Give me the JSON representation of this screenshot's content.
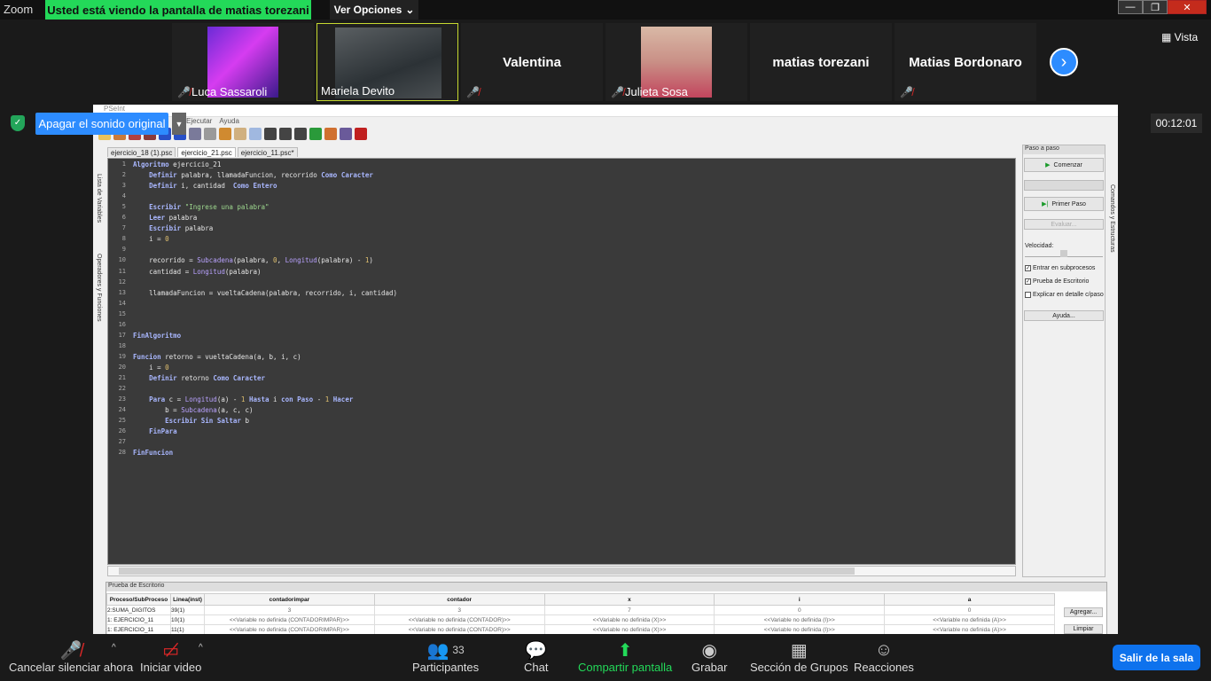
{
  "zoom": {
    "app_label": "Zoom",
    "viewing_banner": "Usted está viendo la pantalla de matias torezani",
    "view_options": "Ver Opciones",
    "view_button": "Vista",
    "audio_button": "Apagar el sonido original",
    "timer": "00:12:01"
  },
  "participants": [
    {
      "name": "Luca Sassaroli",
      "muted": true,
      "video": true
    },
    {
      "name": "Mariela Devito",
      "muted": false,
      "video": true,
      "speaking": true
    },
    {
      "name": "Valentina",
      "muted": true,
      "video": false
    },
    {
      "name": "Julieta Sosa",
      "muted": true,
      "video": true
    },
    {
      "name": "matias torezani",
      "muted": false,
      "video": false
    },
    {
      "name": "Matias Bordonaro",
      "muted": true,
      "video": false
    }
  ],
  "pseint": {
    "title": "PSeInt",
    "menu": [
      "Ejecutar",
      "Ayuda"
    ],
    "tabs": [
      "ejercicio_18 (1).psc",
      "ejercicio_21.psc",
      "ejercicio_11.psc*"
    ],
    "left_labels": [
      "Lista de Variables",
      "Operadores y Funciones"
    ],
    "right_label": "Comandos y Estructuras",
    "panel": {
      "title": "Paso a paso",
      "start": "Comenzar",
      "first_step": "Primer Paso",
      "evaluate": "Evaluar...",
      "speed": "Velocidad:",
      "opt1": "Entrar en subprocesos",
      "opt2": "Prueba de Escritorio",
      "opt3": "Explicar en detalle c/paso",
      "help": "Ayuda..."
    },
    "code": [
      "Algoritmo ejercicio_21",
      "    Definir palabra, llamadaFuncion, recorrido Como Caracter",
      "    Definir i, cantidad  Como Entero",
      "",
      "    Escribir \"Ingrese una palabra\"",
      "    Leer palabra",
      "    Escribir palabra",
      "    i = 0",
      "",
      "    recorrido = Subcadena(palabra, 0, Longitud(palabra) - 1)",
      "    cantidad = Longitud(palabra)",
      "",
      "    llamadaFuncion = vueltaCadena(palabra, recorrido, i, cantidad)",
      "",
      "",
      "",
      "FinAlgoritmo",
      "",
      "Funcion retorno = vueltaCadena(a, b, i, c)",
      "    i = 0",
      "    Definir retorno Como Caracter",
      "",
      "    Para c = Longitud(a) - 1 Hasta i con Paso - 1 Hacer",
      "        b = Subcadena(a, c, c)",
      "        Escribir Sin Saltar b",
      "    FinPara",
      "",
      "FinFuncion"
    ],
    "desk_test": {
      "title": "Prueba de Escritorio",
      "columns": [
        "Proceso/SubProceso",
        "Linea(inst)",
        "contadorimpar",
        "contador",
        "x",
        "i",
        "a"
      ],
      "rows": [
        [
          "2:SUMA_DIGITOS",
          "39(1)",
          "3",
          "3",
          "7",
          "0",
          "0"
        ],
        [
          "1: EJERCICIO_11",
          "10(1)",
          "<<Variable no definida (CONTADORIMPAR)>>",
          "<<Variable no definida (CONTADOR)>>",
          "<<Variable no definida (X)>>",
          "<<Variable no definida (I)>>",
          "<<Variable no definida (A)>>"
        ],
        [
          "1: EJERCICIO_11",
          "11(1)",
          "<<Variable no definida (CONTADORIMPAR)>>",
          "<<Variable no definida (CONTADOR)>>",
          "<<Variable no definida (X)>>",
          "<<Variable no definida (I)>>",
          "<<Variable no definida (A)>>"
        ]
      ],
      "add": "Agregar...",
      "clear": "Limpiar"
    }
  },
  "bottom": {
    "mute": "Cancelar silenciar ahora",
    "video": "Iniciar video",
    "participants": "Participantes",
    "participants_count": "33",
    "chat": "Chat",
    "share": "Compartir pantalla",
    "record": "Grabar",
    "groups": "Sección de Grupos",
    "reactions": "Reacciones",
    "leave": "Salir de la sala"
  },
  "colors": {
    "zoom_green": "#23d959",
    "zoom_blue": "#2d8cff",
    "leave_blue": "#0e72ed",
    "editor_bg": "#3a3a3a"
  }
}
